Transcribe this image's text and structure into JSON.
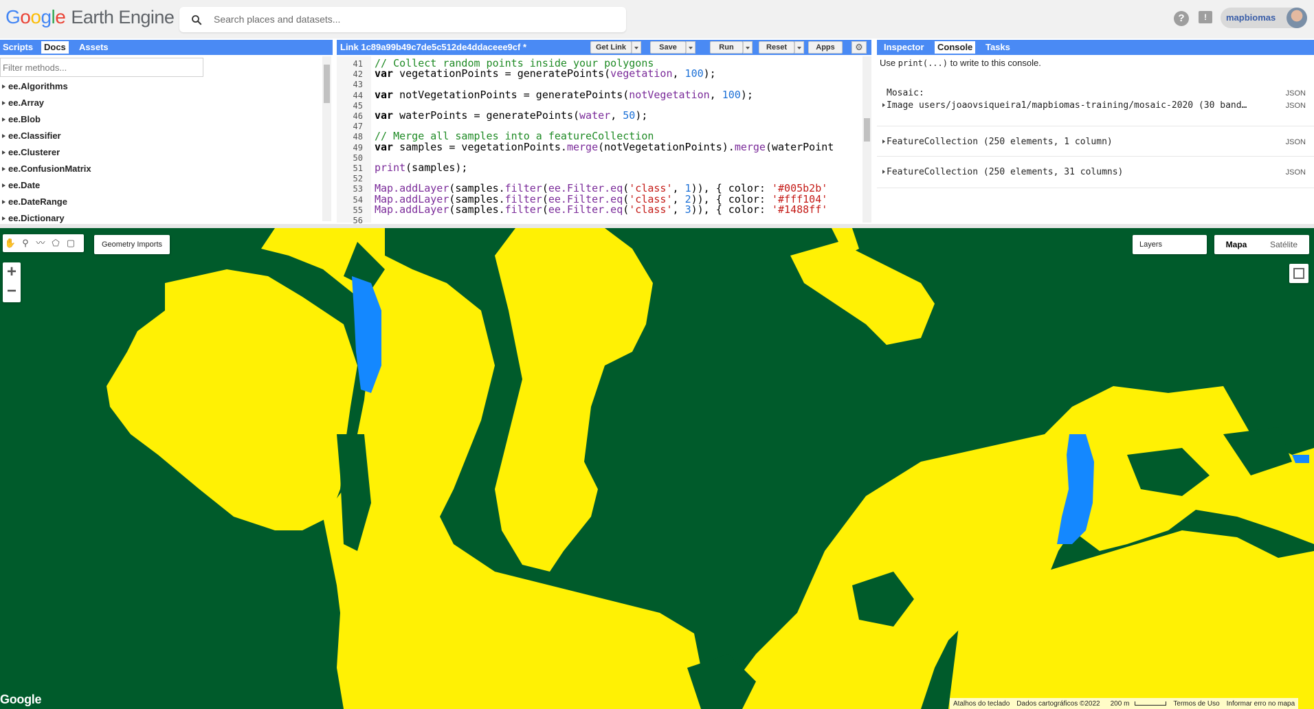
{
  "app": {
    "logo_google": "Google",
    "logo_product": "Earth Engine",
    "search_placeholder": "Search places and datasets...",
    "user": "mapbiomas"
  },
  "left_panel": {
    "tabs": [
      "Scripts",
      "Docs",
      "Assets"
    ],
    "active_tab": "Docs",
    "filter_placeholder": "Filter methods...",
    "items": [
      "ee.Algorithms",
      "ee.Array",
      "ee.Blob",
      "ee.Classifier",
      "ee.Clusterer",
      "ee.ConfusionMatrix",
      "ee.Date",
      "ee.DateRange",
      "ee.Dictionary"
    ]
  },
  "editor": {
    "title": "Link 1c89a99b49c7de5c512de4ddaceee9cf *",
    "buttons": {
      "get_link": "Get Link",
      "save": "Save",
      "run": "Run",
      "reset": "Reset",
      "apps": "Apps"
    },
    "line_numbers": [
      "41",
      "42",
      "43",
      "44",
      "45",
      "46",
      "47",
      "48",
      "49",
      "50",
      "51",
      "52",
      "53",
      "54",
      "55",
      "56"
    ],
    "lines": [
      {
        "n": "41",
        "tokens": [
          [
            "cm",
            "// Collect random points inside your polygons"
          ]
        ]
      },
      {
        "n": "42",
        "tokens": [
          [
            "kw",
            "var"
          ],
          [
            "",
            " vegetationPoints = generatePoints("
          ],
          [
            "fn",
            "vegetation"
          ],
          [
            "",
            ", "
          ],
          [
            "num",
            "100"
          ],
          [
            "",
            ");"
          ]
        ]
      },
      {
        "n": "44",
        "tokens": [
          [
            "kw",
            "var"
          ],
          [
            "",
            " notVegetationPoints = generatePoints("
          ],
          [
            "fn",
            "notVegetation"
          ],
          [
            "",
            ", "
          ],
          [
            "num",
            "100"
          ],
          [
            "",
            ");"
          ]
        ]
      },
      {
        "n": "46",
        "tokens": [
          [
            "kw",
            "var"
          ],
          [
            "",
            " waterPoints = generatePoints("
          ],
          [
            "fn",
            "water"
          ],
          [
            "",
            ", "
          ],
          [
            "num",
            "50"
          ],
          [
            "",
            ");"
          ]
        ]
      },
      {
        "n": "48",
        "tokens": [
          [
            "cm",
            "// Merge all samples into a featureCollection"
          ]
        ]
      },
      {
        "n": "49",
        "tokens": [
          [
            "kw",
            "var"
          ],
          [
            "",
            " samples = vegetationPoints."
          ],
          [
            "fn",
            "merge"
          ],
          [
            "",
            "(notVegetationPoints)."
          ],
          [
            "fn",
            "merge"
          ],
          [
            "",
            "(waterPoint"
          ]
        ]
      },
      {
        "n": "51",
        "tokens": [
          [
            "fn",
            "print"
          ],
          [
            "",
            "(samples);"
          ]
        ]
      },
      {
        "n": "53",
        "tokens": [
          [
            "fn",
            "Map.addLayer"
          ],
          [
            "",
            "(samples."
          ],
          [
            "fn",
            "filter"
          ],
          [
            "",
            "("
          ],
          [
            "fn",
            "ee.Filter.eq"
          ],
          [
            "",
            "("
          ],
          [
            "str",
            "'class'"
          ],
          [
            "",
            ", "
          ],
          [
            "num",
            "1"
          ],
          [
            "",
            ")), { color: "
          ],
          [
            "str",
            "'#005b2b'"
          ]
        ]
      },
      {
        "n": "54",
        "tokens": [
          [
            "fn",
            "Map.addLayer"
          ],
          [
            "",
            "(samples."
          ],
          [
            "fn",
            "filter"
          ],
          [
            "",
            "("
          ],
          [
            "fn",
            "ee.Filter.eq"
          ],
          [
            "",
            "("
          ],
          [
            "str",
            "'class'"
          ],
          [
            "",
            ", "
          ],
          [
            "num",
            "2"
          ],
          [
            "",
            ")), { color: "
          ],
          [
            "str",
            "'#fff104'"
          ]
        ]
      },
      {
        "n": "55",
        "tokens": [
          [
            "fn",
            "Map.addLayer"
          ],
          [
            "",
            "(samples."
          ],
          [
            "fn",
            "filter"
          ],
          [
            "",
            "("
          ],
          [
            "fn",
            "ee.Filter.eq"
          ],
          [
            "",
            "("
          ],
          [
            "str",
            "'class'"
          ],
          [
            "",
            ", "
          ],
          [
            "num",
            "3"
          ],
          [
            "",
            ")), { color: "
          ],
          [
            "str",
            "'#1488ff'"
          ]
        ]
      }
    ]
  },
  "right_panel": {
    "tabs": [
      "Inspector",
      "Console",
      "Tasks"
    ],
    "active_tab": "Console",
    "hint_prefix": "Use ",
    "hint_code": "print(...)",
    "hint_suffix": " to write to this console.",
    "rows": [
      {
        "label": "Mosaic:",
        "json": "JSON"
      },
      {
        "label": "Image users/joaovsiqueira1/mapbiomas-training/mosaic-2020 (30 band…",
        "json": "JSON"
      },
      {
        "label": "FeatureCollection (250 elements, 1 column)",
        "json": "JSON"
      },
      {
        "label": "FeatureCollection (250 elements, 31 columns)",
        "json": "JSON"
      }
    ]
  },
  "map": {
    "geometry_imports": "Geometry Imports",
    "layers": "Layers",
    "map_types": [
      "Mapa",
      "Satélite"
    ],
    "selected_map_type": "Mapa",
    "watermark": "Google",
    "attribution": [
      "Atalhos do teclado",
      "Dados cartográficos ©2022",
      "200 m",
      "Termos de Uso",
      "Informar erro no mapa"
    ],
    "colors": {
      "vegetation": "#005b2b",
      "not_vegetation": "#fff104",
      "water": "#1488ff"
    }
  }
}
